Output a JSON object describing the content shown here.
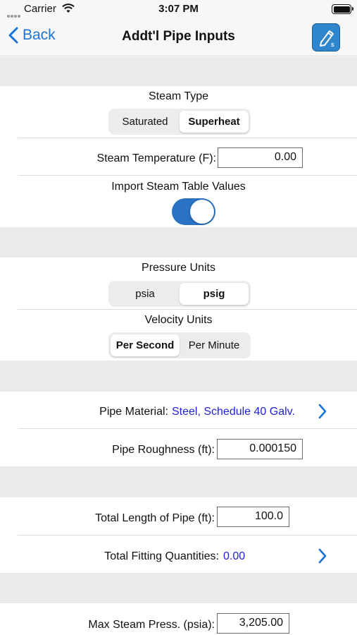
{
  "status_bar": {
    "carrier": "Carrier",
    "time": "3:07 PM"
  },
  "nav": {
    "back_label": "Back",
    "title": "Addt'l Pipe Inputs"
  },
  "steam_type": {
    "label": "Steam Type",
    "options": [
      "Saturated",
      "Superheat"
    ],
    "selected": "Superheat"
  },
  "steam_temperature": {
    "label": "Steam Temperature (F):",
    "value": "0.00"
  },
  "import_steam": {
    "label": "Import Steam Table Values",
    "on": true
  },
  "pressure_units": {
    "label": "Pressure Units",
    "options": [
      "psia",
      "psig"
    ],
    "selected": "psig"
  },
  "velocity_units": {
    "label": "Velocity Units",
    "options": [
      "Per Second",
      "Per Minute"
    ],
    "selected": "Per Second"
  },
  "pipe_material": {
    "label": "Pipe Material:",
    "value": "Steel, Schedule 40 Galv."
  },
  "pipe_roughness": {
    "label": "Pipe Roughness (ft):",
    "value": "0.000150"
  },
  "total_length": {
    "label": "Total Length of Pipe (ft):",
    "value": "100.0"
  },
  "fitting_quantities": {
    "label": "Total Fitting Quantities:",
    "value": "0.00"
  },
  "max_steam_press": {
    "label": "Max Steam Press. (psia):",
    "value": "3,205.00"
  },
  "colors": {
    "accent": "#1a73d9",
    "link": "#2222d6",
    "toggle_on": "#2a72c4",
    "section_gap": "#ebebeb"
  },
  "icons": [
    "back-chevron-icon",
    "app-edit-icon",
    "wifi-icon",
    "battery-icon",
    "chevron-right-icon"
  ]
}
